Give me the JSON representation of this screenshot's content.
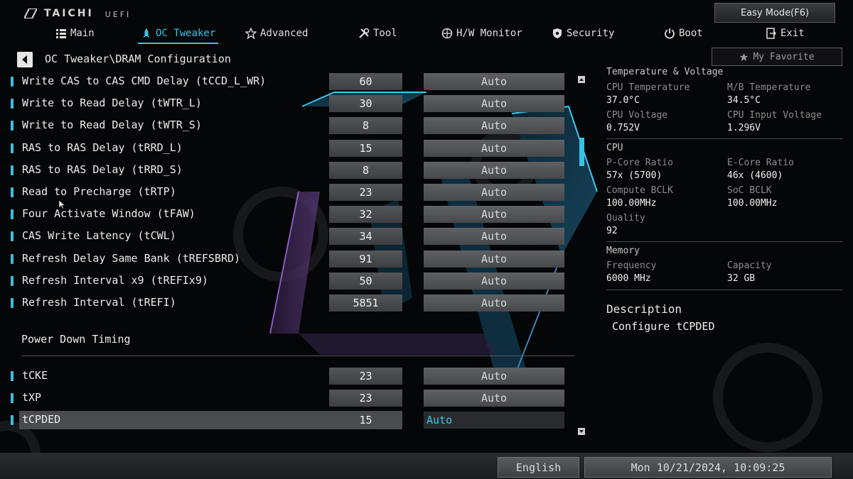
{
  "logo": {
    "brand": "TAICHI",
    "sub": "UEFI"
  },
  "top": {
    "easy_mode": "Easy Mode(F6)"
  },
  "menu": [
    {
      "label": "Main",
      "icon": "list-icon",
      "active": false
    },
    {
      "label": "OC Tweaker",
      "icon": "rocket-icon",
      "active": true
    },
    {
      "label": "Advanced",
      "icon": "star-icon",
      "active": false
    },
    {
      "label": "Tool",
      "icon": "tool-icon",
      "active": false
    },
    {
      "label": "H/W Monitor",
      "icon": "monitor-icon",
      "active": false
    },
    {
      "label": "Security",
      "icon": "shield-icon",
      "active": false
    },
    {
      "label": "Boot",
      "icon": "power-icon",
      "active": false
    },
    {
      "label": "Exit",
      "icon": "exit-icon",
      "active": false
    }
  ],
  "breadcrumb": "OC Tweaker\\DRAM Configuration",
  "favorite": "My Favorite",
  "settings": [
    {
      "label": "Write CAS to CAS CMD Delay (tCCD_L_WR)",
      "value": "60",
      "mode": "Auto"
    },
    {
      "label": "Write to Read Delay (tWTR_L)",
      "value": "30",
      "mode": "Auto"
    },
    {
      "label": "Write to Read Delay (tWTR_S)",
      "value": "8",
      "mode": "Auto"
    },
    {
      "label": "RAS to RAS Delay (tRRD_L)",
      "value": "15",
      "mode": "Auto"
    },
    {
      "label": "RAS to RAS Delay (tRRD_S)",
      "value": "8",
      "mode": "Auto"
    },
    {
      "label": "Read to Precharge (tRTP)",
      "value": "23",
      "mode": "Auto"
    },
    {
      "label": "Four Activate Window (tFAW)",
      "value": "32",
      "mode": "Auto"
    },
    {
      "label": "CAS Write Latency (tCWL)",
      "value": "34",
      "mode": "Auto"
    },
    {
      "label": "Refresh Delay Same Bank (tREFSBRD)",
      "value": "91",
      "mode": "Auto"
    },
    {
      "label": "Refresh Interval x9 (tREFIx9)",
      "value": "50",
      "mode": "Auto"
    },
    {
      "label": "Refresh Interval (tREFI)",
      "value": "5851",
      "mode": "Auto"
    }
  ],
  "section": "Power Down Timing",
  "power_settings": [
    {
      "label": "tCKE",
      "value": "23",
      "mode": "Auto"
    },
    {
      "label": "tXP",
      "value": "23",
      "mode": "Auto"
    },
    {
      "label": "tCPDED",
      "value": "15",
      "mode": "Auto",
      "selected": true
    }
  ],
  "panel": {
    "tv_title": "Temperature & Voltage",
    "cpu_temp_label": "CPU Temperature",
    "cpu_temp": "37.0°C",
    "mb_temp_label": "M/B Temperature",
    "mb_temp": "34.5°C",
    "cpu_volt_label": "CPU Voltage",
    "cpu_volt": "0.752V",
    "cpu_in_volt_label": "CPU Input Voltage",
    "cpu_in_volt": "1.296V",
    "cpu_title": "CPU",
    "pcore_label": "P-Core Ratio",
    "pcore": "57x (5700)",
    "ecore_label": "E-Core Ratio",
    "ecore": "46x (4600)",
    "cbclk_label": "Compute BCLK",
    "cbclk": "100.00MHz",
    "socbclk_label": "SoC BCLK",
    "socbclk": "100.00MHz",
    "quality_label": "Quality",
    "quality": "92",
    "mem_title": "Memory",
    "freq_label": "Frequency",
    "freq": "6000 MHz",
    "cap_label": "Capacity",
    "cap": "32 GB"
  },
  "description": {
    "title": "Description",
    "text": "Configure tCPDED"
  },
  "bottom": {
    "language": "English",
    "datetime": "Mon 10/21/2024, 10:09:25"
  },
  "colors": {
    "accent": "#35c4e8",
    "bg": "#050607",
    "field": "#4a4b4e"
  }
}
